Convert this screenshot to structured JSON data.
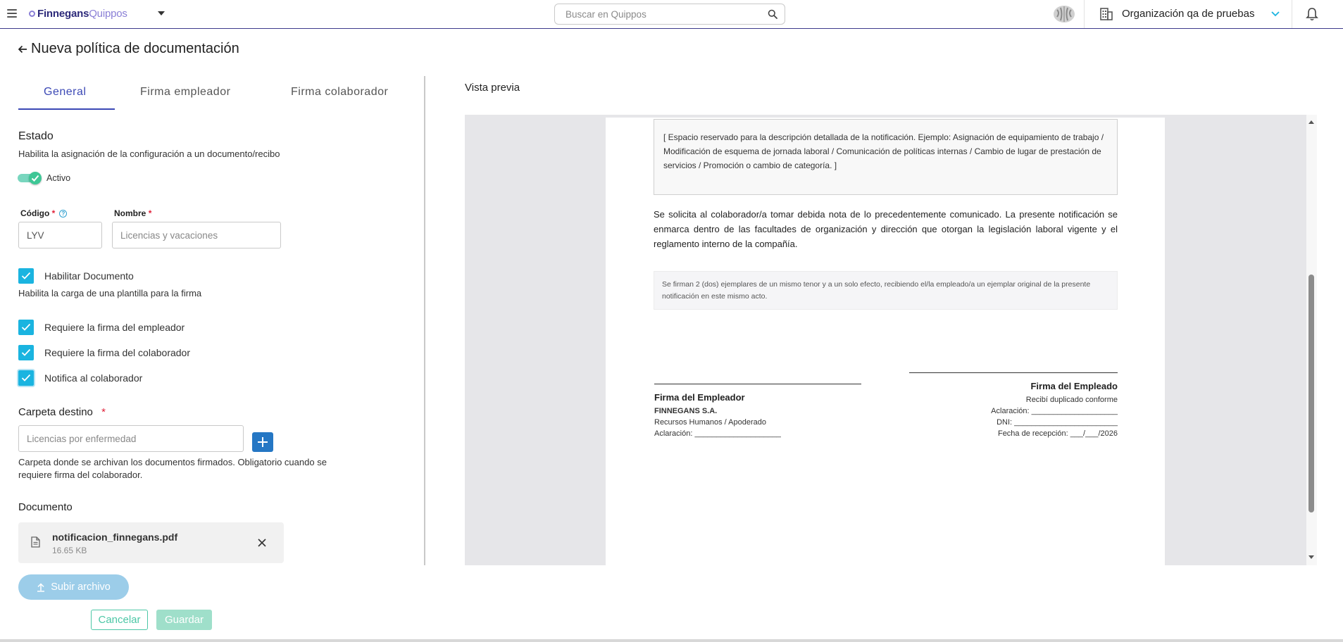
{
  "header": {
    "logo_brand": "Finnegans",
    "logo_product": "Quippos",
    "search_placeholder": "Buscar en Quippos",
    "organization": "Organización qa de pruebas"
  },
  "page": {
    "title": "Nueva política de documentación"
  },
  "tabs": [
    {
      "label": "General",
      "active": true
    },
    {
      "label": "Firma empleador",
      "active": false
    },
    {
      "label": "Firma colaborador",
      "active": false
    }
  ],
  "estado": {
    "heading": "Estado",
    "description": "Habilita la asignación de la configuración a un documento/recibo",
    "toggle_label": "Activo",
    "toggle_on": true
  },
  "codigo": {
    "label": "Código",
    "required_mark": "*",
    "value": "LYV"
  },
  "nombre": {
    "label": "Nombre",
    "required_mark": "*",
    "placeholder": "Licencias y vacaciones"
  },
  "checks": {
    "habilitar": {
      "label": "Habilitar Documento",
      "checked": true
    },
    "habilitar_desc": "Habilita la carga de una plantilla para la firma",
    "empleador": {
      "label": "Requiere la firma del empleador",
      "checked": true
    },
    "colaborador": {
      "label": "Requiere la firma del colaborador",
      "checked": true
    },
    "notifica": {
      "label": "Notifica al colaborador",
      "checked": true
    }
  },
  "carpeta": {
    "heading": "Carpeta destino",
    "required_mark": "*",
    "placeholder": "Licencias por enfermedad",
    "description_line1": "Carpeta donde se archivan los documentos firmados. Obligatorio cuando se",
    "description_line2": "requiere firma del colaborador."
  },
  "documento": {
    "heading": "Documento",
    "file_name": "notificacion_finnegans.pdf",
    "file_size": "16.65 KB"
  },
  "buttons": {
    "upload": "Subir archivo",
    "cancel": "Cancelar",
    "save": "Guardar"
  },
  "preview": {
    "title": "Vista previa",
    "box_text": "[ Espacio reservado para la descripción detallada de la notificación. Ejemplo: Asignación de equipamiento de trabajo / Modificación de esquema de jornada laboral / Comunicación de políticas internas / Cambio de lugar de prestación de servicios / Promoción o cambio de categoría. ]",
    "paragraph": "Se solicita al colaborador/a tomar debida nota de lo precedentemente comunicado. La presente notificación se enmarca dentro de las facultades de organización y dirección que otorgan la legislación laboral vigente y el reglamento interno de la compañía.",
    "note": "Se firman 2 (dos) ejemplares de un mismo tenor y a un solo efecto, recibiendo el/la empleado/a un ejemplar original de la presente notificación en este mismo acto.",
    "employer_sig": {
      "title": "Firma del Empleador",
      "company": "FINNEGANS S.A.",
      "role": "Recursos Humanos / Apoderado",
      "aclaracion": "Aclaración: ____________________"
    },
    "employee_sig": {
      "title": "Firma del Empleado",
      "line1": "Recibí duplicado conforme",
      "aclaracion": "Aclaración: ____________________",
      "dni": "DNI: ________________________",
      "fecha": "Fecha de recepción: ___/___/2026"
    }
  }
}
